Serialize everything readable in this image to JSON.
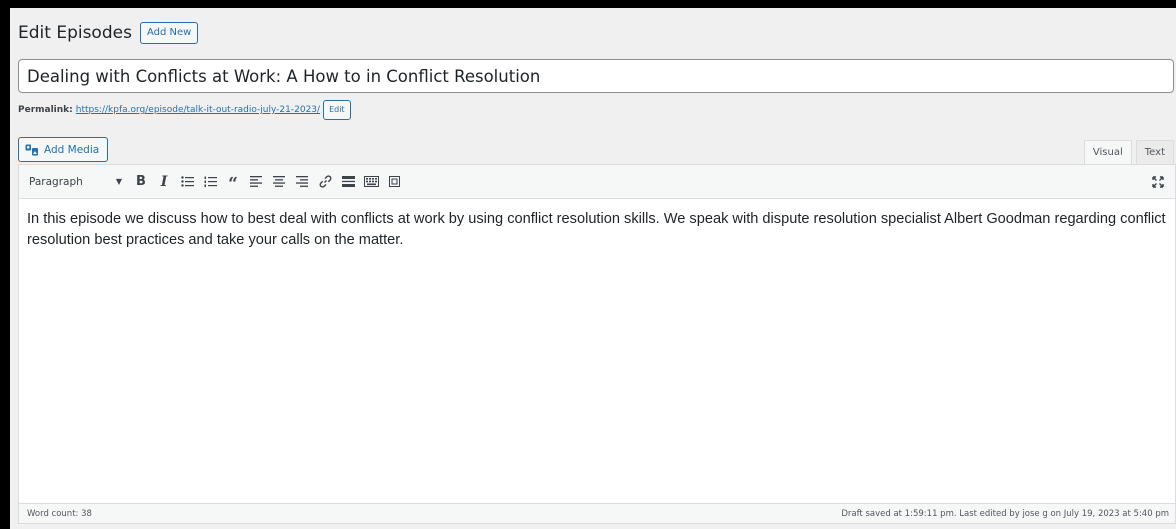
{
  "header": {
    "title": "Edit Episodes",
    "add_new_label": "Add New"
  },
  "post": {
    "title_value": "Dealing with Conflicts at Work: A How to in Conflict Resolution"
  },
  "permalink": {
    "label": "Permalink:",
    "url": "https://kpfa.org/episode/talk-it-out-radio-july-21-2023/",
    "edit_label": "Edit"
  },
  "media": {
    "add_media_label": "Add Media"
  },
  "editor_tabs": {
    "visual": "Visual",
    "text": "Text"
  },
  "toolbar": {
    "format_value": "Paragraph",
    "bold_glyph": "B",
    "italic_glyph": "I",
    "quote_glyph": "“"
  },
  "content": {
    "body": "In this episode we discuss how to best deal with conflicts at work by using conflict resolution skills. We speak with dispute resolution specialist Albert Goodman regarding conflict resolution best practices and take your calls on the matter."
  },
  "status": {
    "word_count": "Word count: 38",
    "draft_saved": "Draft saved at 1:59:11 pm. Last edited by jose g on July 19, 2023 at 5:40 pm"
  },
  "colors": {
    "accent": "#2271b1",
    "background": "#f0f0f1",
    "border": "#dcdcde"
  }
}
